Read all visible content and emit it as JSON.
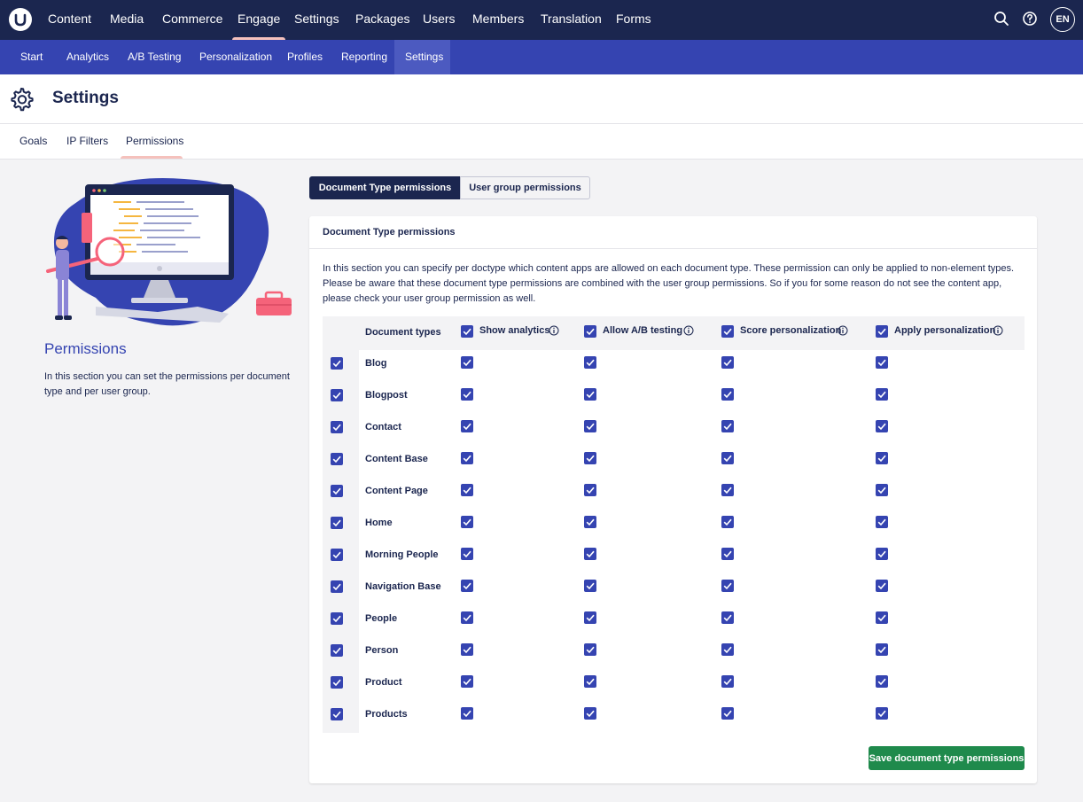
{
  "topnav": {
    "items": [
      "Content",
      "Media",
      "Commerce",
      "Engage",
      "Settings",
      "Packages",
      "Users",
      "Members",
      "Translation",
      "Forms"
    ],
    "active": "Engage",
    "avatar": "EN"
  },
  "subnav": {
    "items": [
      "Start",
      "Analytics",
      "A/B Testing",
      "Personalization",
      "Profiles",
      "Reporting",
      "Settings"
    ],
    "active": "Settings"
  },
  "header": {
    "title": "Settings"
  },
  "tabs": {
    "items": [
      "Goals",
      "IP Filters",
      "Permissions"
    ],
    "active": "Permissions"
  },
  "left": {
    "title": "Permissions",
    "description": "In this section you can set the permissions per document type and per user group."
  },
  "toggle": {
    "active": "Document Type permissions",
    "inactive": "User group permissions"
  },
  "panel": {
    "title": "Document Type permissions",
    "description": "In this section you can specify per doctype which content apps are allowed on each document type. These permission can only be applied to non-element types. Please be aware that these document type permissions are combined with the user group permissions. So if you for some reason do not see the content app, please check your user group permission as well.",
    "columns": {
      "doc_types": "Document types",
      "show_analytics": "Show analytics",
      "allow_ab": "Allow A/B testing",
      "score_personalization": "Score personalization",
      "apply_personalization": "Apply personalization"
    },
    "rows": [
      "Blog",
      "Blogpost",
      "Contact",
      "Content Base",
      "Content Page",
      "Home",
      "Morning People",
      "Navigation Base",
      "People",
      "Person",
      "Product",
      "Products"
    ],
    "all_checked": true,
    "save_label": "Save document type permissions"
  },
  "colors": {
    "topbar": "#1b264f",
    "subnav": "#3544b1",
    "checkbox": "#3544b1",
    "save": "#1f8a4c",
    "accent_underline": "#f5c1bc"
  }
}
